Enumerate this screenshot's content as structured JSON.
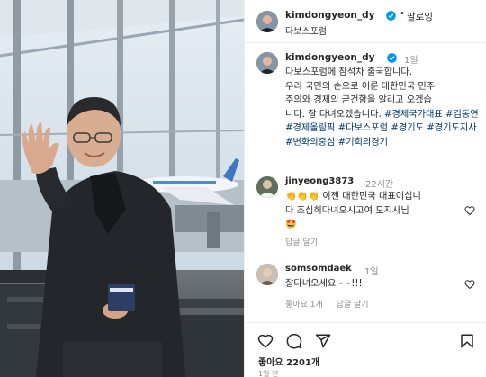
{
  "header": {
    "username": "kimdongyeon_dy",
    "separator": "•",
    "follow_label": "팔로잉",
    "location": "다보스포럼"
  },
  "caption": {
    "username": "kimdongyeon_dy",
    "time": "1일",
    "lines": [
      "다보스포럼에 참석차 출국합니다.",
      "우리 국민의 손으로 이룬 대한민국 민주",
      "주의와 경제의 굳건함을 알리고 오겠습",
      "니다. 잘 다녀오겠습니다. "
    ],
    "hashtags": [
      "#경제국가대표",
      "#김동연",
      "#경제올림픽",
      "#다보스포럼",
      "#경기도",
      "#경기도지사",
      "#변화의중심",
      "#기회의경기"
    ]
  },
  "comments": [
    {
      "username": "jinyeong3873",
      "time": "22시간",
      "text_line1": "👏👏👏 이젠 대한민국 대표이십니",
      "text_line2": "다 조심히다녀오시고여 도지사님",
      "text_line3": "🤩",
      "reply_label": "답글 달기"
    },
    {
      "username": "somsomdaek",
      "time": "1일",
      "text_line1": "잘다녀오세요~~!!!!",
      "likes_label": "좋아요 1개",
      "reply_label": "답글 달기"
    }
  ],
  "actions": {
    "like_icon": "heart-icon",
    "comment_icon": "comment-icon",
    "share_icon": "paper-plane-icon",
    "save_icon": "bookmark-icon"
  },
  "likes_text": "좋아요 2201개",
  "posted_ago": "1일 전",
  "colors": {
    "verified_blue": "#0095f6",
    "hashtag_link": "#00376b",
    "secondary_text": "#8e8e8e",
    "divider": "#efefef"
  }
}
